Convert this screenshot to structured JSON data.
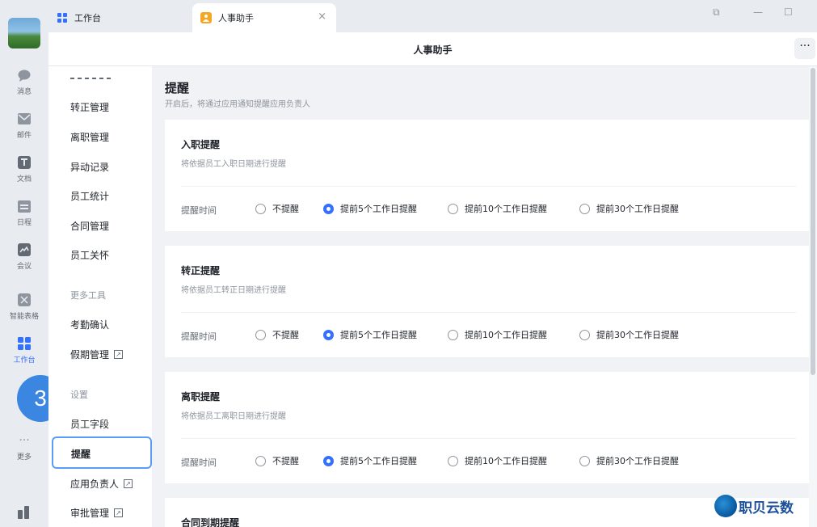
{
  "rail": {
    "items": [
      {
        "label": "消息",
        "icon": "chat-icon"
      },
      {
        "label": "邮件",
        "icon": "mail-icon"
      },
      {
        "label": "文档",
        "icon": "document-icon"
      },
      {
        "label": "日程",
        "icon": "calendar-icon"
      },
      {
        "label": "会议",
        "icon": "meeting-icon"
      },
      {
        "label": "智能表格",
        "icon": "smart-table-icon"
      },
      {
        "label": "工作台",
        "icon": "workbench-icon"
      },
      {
        "label": "更多",
        "icon": "more-icon"
      }
    ]
  },
  "tabs": [
    {
      "label": "工作台"
    },
    {
      "label": "人事助手",
      "close": "×"
    }
  ],
  "window": {
    "restore": "⧉",
    "minimize": "—",
    "maximize": "☐"
  },
  "header": {
    "title": "人事助手",
    "more": "···"
  },
  "nav": {
    "items": [
      "转正管理",
      "离职管理",
      "异动记录",
      "员工统计",
      "合同管理",
      "员工关怀"
    ],
    "group_tools": "更多工具",
    "tools": [
      "考勤确认",
      "假期管理"
    ],
    "group_settings": "设置",
    "settings": [
      "员工字段",
      "提醒",
      "应用负责人",
      "审批管理"
    ]
  },
  "step_marker": "3",
  "main": {
    "title": "提醒",
    "subtitle": "开启后，将通过应用通知提醒应用负责人",
    "cards": [
      {
        "title": "入职提醒",
        "desc": "将依据员工入职日期进行提醒",
        "label": "提醒时间",
        "options": [
          "不提醒",
          "提前5个工作日提醒",
          "提前10个工作日提醒",
          "提前30个工作日提醒"
        ]
      },
      {
        "title": "转正提醒",
        "desc": "将依据员工转正日期进行提醒",
        "label": "提醒时间",
        "options": [
          "不提醒",
          "提前5个工作日提醒",
          "提前10个工作日提醒",
          "提前30个工作日提醒"
        ]
      },
      {
        "title": "离职提醒",
        "desc": "将依据员工离职日期进行提醒",
        "label": "提醒时间",
        "options": [
          "不提醒",
          "提前5个工作日提醒",
          "提前10个工作日提醒",
          "提前30个工作日提醒"
        ]
      },
      {
        "title": "合同到期提醒"
      }
    ],
    "selected_option": "提前5个工作日提醒"
  },
  "watermark": "职贝云数",
  "colors": {
    "accent": "#3370ff",
    "highlight_border": "#5b9cf6",
    "step_marker": "#3b86e0"
  }
}
